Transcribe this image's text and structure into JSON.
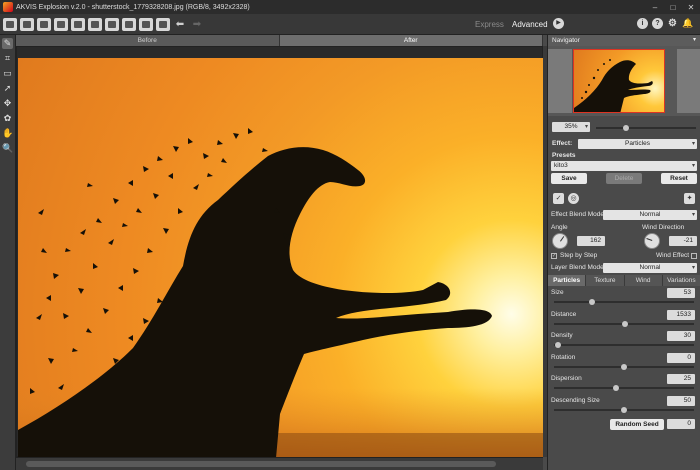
{
  "window": {
    "title": "AKVIS Explosion v.2.0 - shutterstock_1779328208.jpg (RGB/8, 3492x2328)"
  },
  "modes": {
    "express": "Express",
    "advanced": "Advanced"
  },
  "view_tabs": {
    "before": "Before",
    "after": "After"
  },
  "navigator": {
    "title": "Navigator",
    "zoom": "35%"
  },
  "effect": {
    "label": "Effect:",
    "value": "Particles"
  },
  "presets": {
    "label": "Presets",
    "value": "kito3",
    "save": "Save",
    "delete": "Delete",
    "reset": "Reset"
  },
  "blend": {
    "effect_label": "Effect Blend Mode",
    "effect_value": "Normal",
    "layer_label": "Layer Blend Mode",
    "layer_value": "Normal"
  },
  "angle": {
    "label": "Angle",
    "value": "162"
  },
  "wind_direction": {
    "label": "Wind Direction",
    "value": "-21"
  },
  "step_by_step": {
    "label": "Step by Step",
    "checked": true
  },
  "wind_effect": {
    "label": "Wind Effect",
    "checked": false
  },
  "param_tabs": [
    "Particles",
    "Texture",
    "Wind",
    "Variations"
  ],
  "params": [
    {
      "label": "Size",
      "value": "53",
      "level": 0.27
    },
    {
      "label": "Distance",
      "value": "1533",
      "level": 0.51
    },
    {
      "label": "Density",
      "value": "30",
      "level": 0.03
    },
    {
      "label": "Rotation",
      "value": "0",
      "level": 0.5
    },
    {
      "label": "Dispersion",
      "value": "25",
      "level": 0.44
    },
    {
      "label": "Descending Size",
      "value": "50",
      "level": 0.5
    }
  ],
  "random_seed": {
    "label": "Random Seed",
    "value": "0"
  },
  "colors": {
    "accent": "#d32f2f",
    "sky_top": "#e07a1e",
    "sun": "#fffde8",
    "silhouette": "#151008"
  }
}
